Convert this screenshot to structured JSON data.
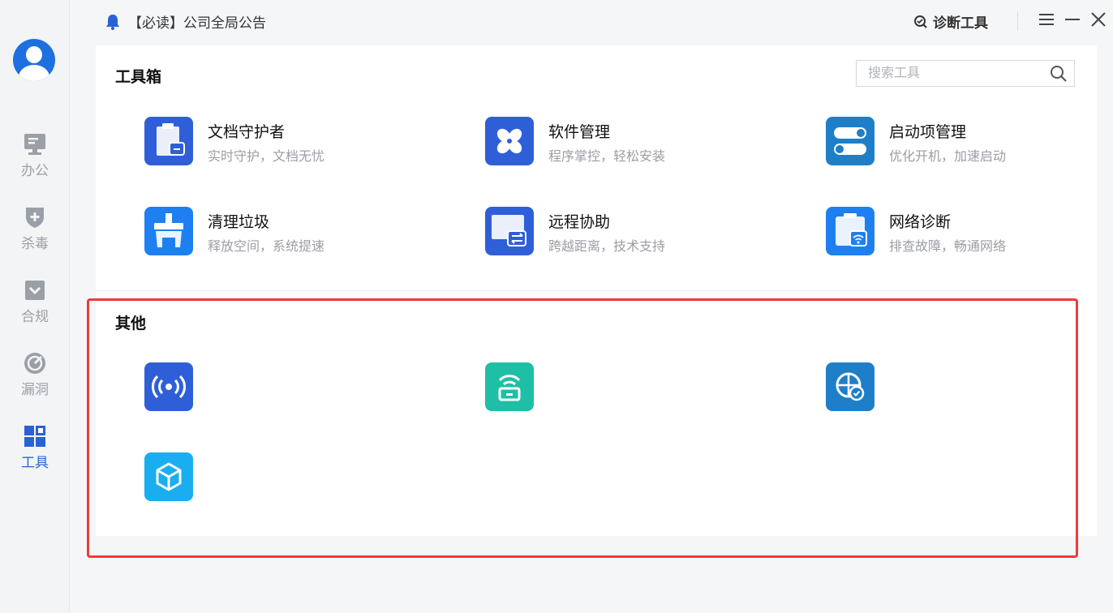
{
  "topbar": {
    "notice": "【必读】公司全局公告",
    "diagnose_label": "诊断工具"
  },
  "sidebar": {
    "items": [
      {
        "label": "办公",
        "icon": "monitor-icon"
      },
      {
        "label": "杀毒",
        "icon": "shield-plus-icon"
      },
      {
        "label": "合规",
        "icon": "checkbox-icon"
      },
      {
        "label": "漏洞",
        "icon": "radar-icon"
      },
      {
        "label": "工具",
        "icon": "grid-icon"
      }
    ],
    "active": "工具"
  },
  "toolbox": {
    "title": "工具箱",
    "search_placeholder": "搜索工具",
    "tools": [
      {
        "name": "文档守护者",
        "desc": "实时守护，文档无忧",
        "icon": "document-guard-icon",
        "color": "#2f5fd8"
      },
      {
        "name": "软件管理",
        "desc": "程序掌控，轻松安装",
        "icon": "software-manage-icon",
        "color": "#2f5fd8"
      },
      {
        "name": "启动项管理",
        "desc": "优化开机，加速启动",
        "icon": "startup-toggle-icon",
        "color": "#1e7fc8"
      },
      {
        "name": "清理垃圾",
        "desc": "释放空间，系统提速",
        "icon": "cleanup-icon",
        "color": "#1e80f0"
      },
      {
        "name": "远程协助",
        "desc": "跨越距离，技术支持",
        "icon": "remote-assist-icon",
        "color": "#2f5fd8"
      },
      {
        "name": "网络诊断",
        "desc": "排查故障，畅通网络",
        "icon": "network-diagnose-icon",
        "color": "#1e80f0"
      }
    ]
  },
  "others": {
    "title": "其他",
    "tools": [
      {
        "name": "",
        "desc": "",
        "icon": "broadcast-icon",
        "color": "#2f5fd8"
      },
      {
        "name": "",
        "desc": "",
        "icon": "router-icon",
        "color": "#1fbfa5"
      },
      {
        "name": "",
        "desc": "",
        "icon": "globe-check-icon",
        "color": "#1e7fc8"
      },
      {
        "name": "",
        "desc": "",
        "icon": "cube-icon",
        "color": "#1aaef0"
      }
    ]
  }
}
